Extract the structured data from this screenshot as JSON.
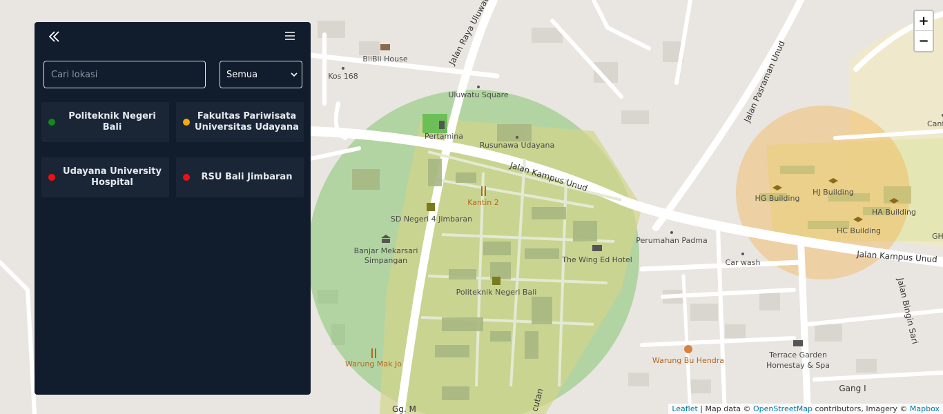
{
  "panel": {
    "collapse_icon": "double-chevron-left-icon",
    "menu_icon": "hamburger-icon",
    "search_placeholder": "Cari lokasi",
    "filter_value": "Semua",
    "locations": [
      {
        "name": "Politeknik Negeri Bali",
        "status_color": "#138a13"
      },
      {
        "name": "Fakultas Pariwisata Universitas Udayana",
        "status_color": "#f5a90f"
      },
      {
        "name": "Udayana University Hospital",
        "status_color": "#ee1010"
      },
      {
        "name": "RSU Bali Jimbaran",
        "status_color": "#ee1010"
      }
    ]
  },
  "zoom": {
    "in_label": "+",
    "out_label": "−"
  },
  "attribution": {
    "leaflet": "Leaflet",
    "map_data": "| Map data ©",
    "osm": "OpenStreetMap",
    "contributors": "contributors, Imagery ©",
    "mapbox": "Mapbox"
  },
  "map": {
    "circle_colors": {
      "green": "#6cbf57",
      "orange": "#f4b04a"
    },
    "labels": {
      "bilibili_house": "BliBli House",
      "kos_168": "Kos 168",
      "jalan_raya_uluwatu": "Jalan Raya Uluwatu",
      "uluwatu_square": "Uluwatu Square",
      "pertamina": "Pertamina",
      "rusunawa": "Rusunawa Udayana",
      "jalan_kampus_unud": "Jalan Kampus Unud",
      "kantin_2": "Kantin 2",
      "sd_negeri": "SD Negeri 4 Jimbaran",
      "banjar_1": "Banjar Mekarsari",
      "banjar_2": "Simpangan",
      "wing_ed": "The Wing Ed Hotel",
      "perumahan_padma": "Perumahan Padma",
      "car_wash": "Car wash",
      "poltek": "Politeknik Negeri Bali",
      "warung_mak_jo": "Warung Mak Jo",
      "warung_bu_hendra": "Warung Bu Hendra",
      "terrace_1": "Terrace Garden",
      "terrace_2": "Homestay & Spa",
      "gang_1": "Gang I",
      "jalan_pasraman": "Jalan Pasraman Unud",
      "jalan_kampus_unud_2": "Jalan Kampus Unud",
      "jalan_bingin_sari": "Jalan Bingin Sari",
      "hg_building": "HG Building",
      "hj_building": "HJ Building",
      "ha_building": "HA Building",
      "hc_building": "HC Building",
      "gh": "GH",
      "cant": "Cant",
      "gg_m": "Gg. M",
      "cutan": "cutan"
    }
  }
}
